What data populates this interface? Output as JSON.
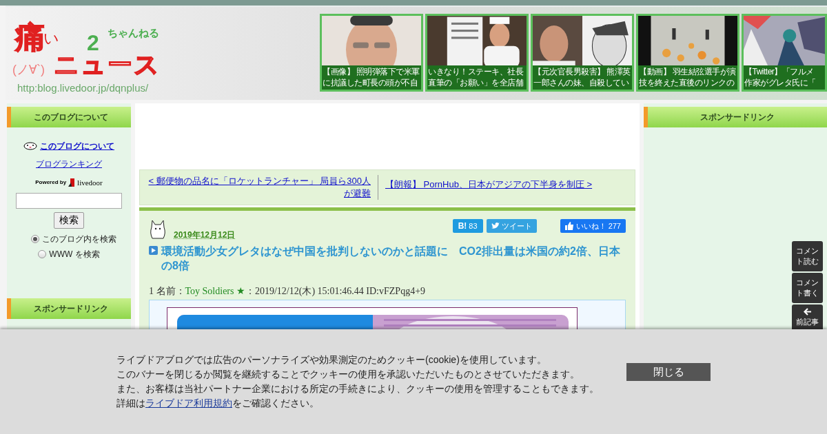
{
  "header": {
    "logo": {
      "main_kanji": "痛",
      "hiragana": "い",
      "news": "ニュース",
      "two": "2",
      "channel": "ちゃんねる",
      "face": "(ノ∀`)",
      "url": "http:blog.livedoor.jp/dqnplus/"
    },
    "thumbnails": [
      {
        "caption_lines": [
          "【画像】 照明弾落下で米軍",
          "に抗議した町長の頭が不自"
        ]
      },
      {
        "caption_lines": [
          "いきなり！ステーキ、社長",
          "直筆の「お願い」を全店舗"
        ]
      },
      {
        "caption_lines": [
          "【元次官長男殺害】 熊澤英",
          "一郎さんの妹、自殺してい"
        ]
      },
      {
        "caption_lines": [
          "【動画】 羽生結弦選手が演",
          "技を終えた直後のリンクの"
        ]
      },
      {
        "caption_lines": [
          "【Twitter】「フルメ",
          "作家がグレタ氏に「"
        ]
      }
    ]
  },
  "left_sidebar": {
    "heading": "このブログについて",
    "about_link": "このブログについて",
    "ranking_link": "ブログランキング",
    "powered_by": "Powered by",
    "brand": "livedoor",
    "search_button": "検索",
    "search_scope": [
      {
        "label": "このブログ内を検索",
        "selected": true
      },
      {
        "label": "WWW を検索",
        "selected": false
      }
    ],
    "sponsor_heading": "スポンサードリンク"
  },
  "article_nav": {
    "prev": "< 郵便物の品名に「ロケットランチャー」 局員ら300人が避難",
    "next": "【朗報】 PornHub、日本がアジアの下半身を制圧 >"
  },
  "article": {
    "date": "2019年12月12日",
    "hatena_label": "B!",
    "hatena_count": "83",
    "tweet": "ツイート",
    "like": "いいね！",
    "like_count": "277",
    "title": "環境活動少女グレタはなぜ中国を批判しないのかと話題に　CO2排出量は米国の約2倍、日本の8倍",
    "post": {
      "number": "1",
      "name_label": "名前：",
      "name": "Toy Soldiers ★",
      "meta": "：2019/12/12(木) 15:01:46.44 ID:vFZPqg4+9"
    }
  },
  "right_sidebar": {
    "heading": "スポンサードリンク"
  },
  "floating_buttons": [
    {
      "kind": "text",
      "label": "コメント読む"
    },
    {
      "kind": "text",
      "label": "コメント書く"
    },
    {
      "kind": "arrow",
      "label": "前記事"
    }
  ],
  "cookie_banner": {
    "lines": [
      "ライブドアブログでは広告のパーソナライズや効果測定のためクッキー(cookie)を使用しています。",
      "このバナーを閉じるか閲覧を継続することでクッキーの使用を承認いただいたものとさせていただきます。",
      "また、お客様は当社パートナー企業における所定の手続きにより、クッキーの使用を管理することもできます。"
    ],
    "last_before": "詳細は",
    "link": "ライブドア利用規約",
    "last_after": "をご確認ください。",
    "close": "閉じる"
  }
}
